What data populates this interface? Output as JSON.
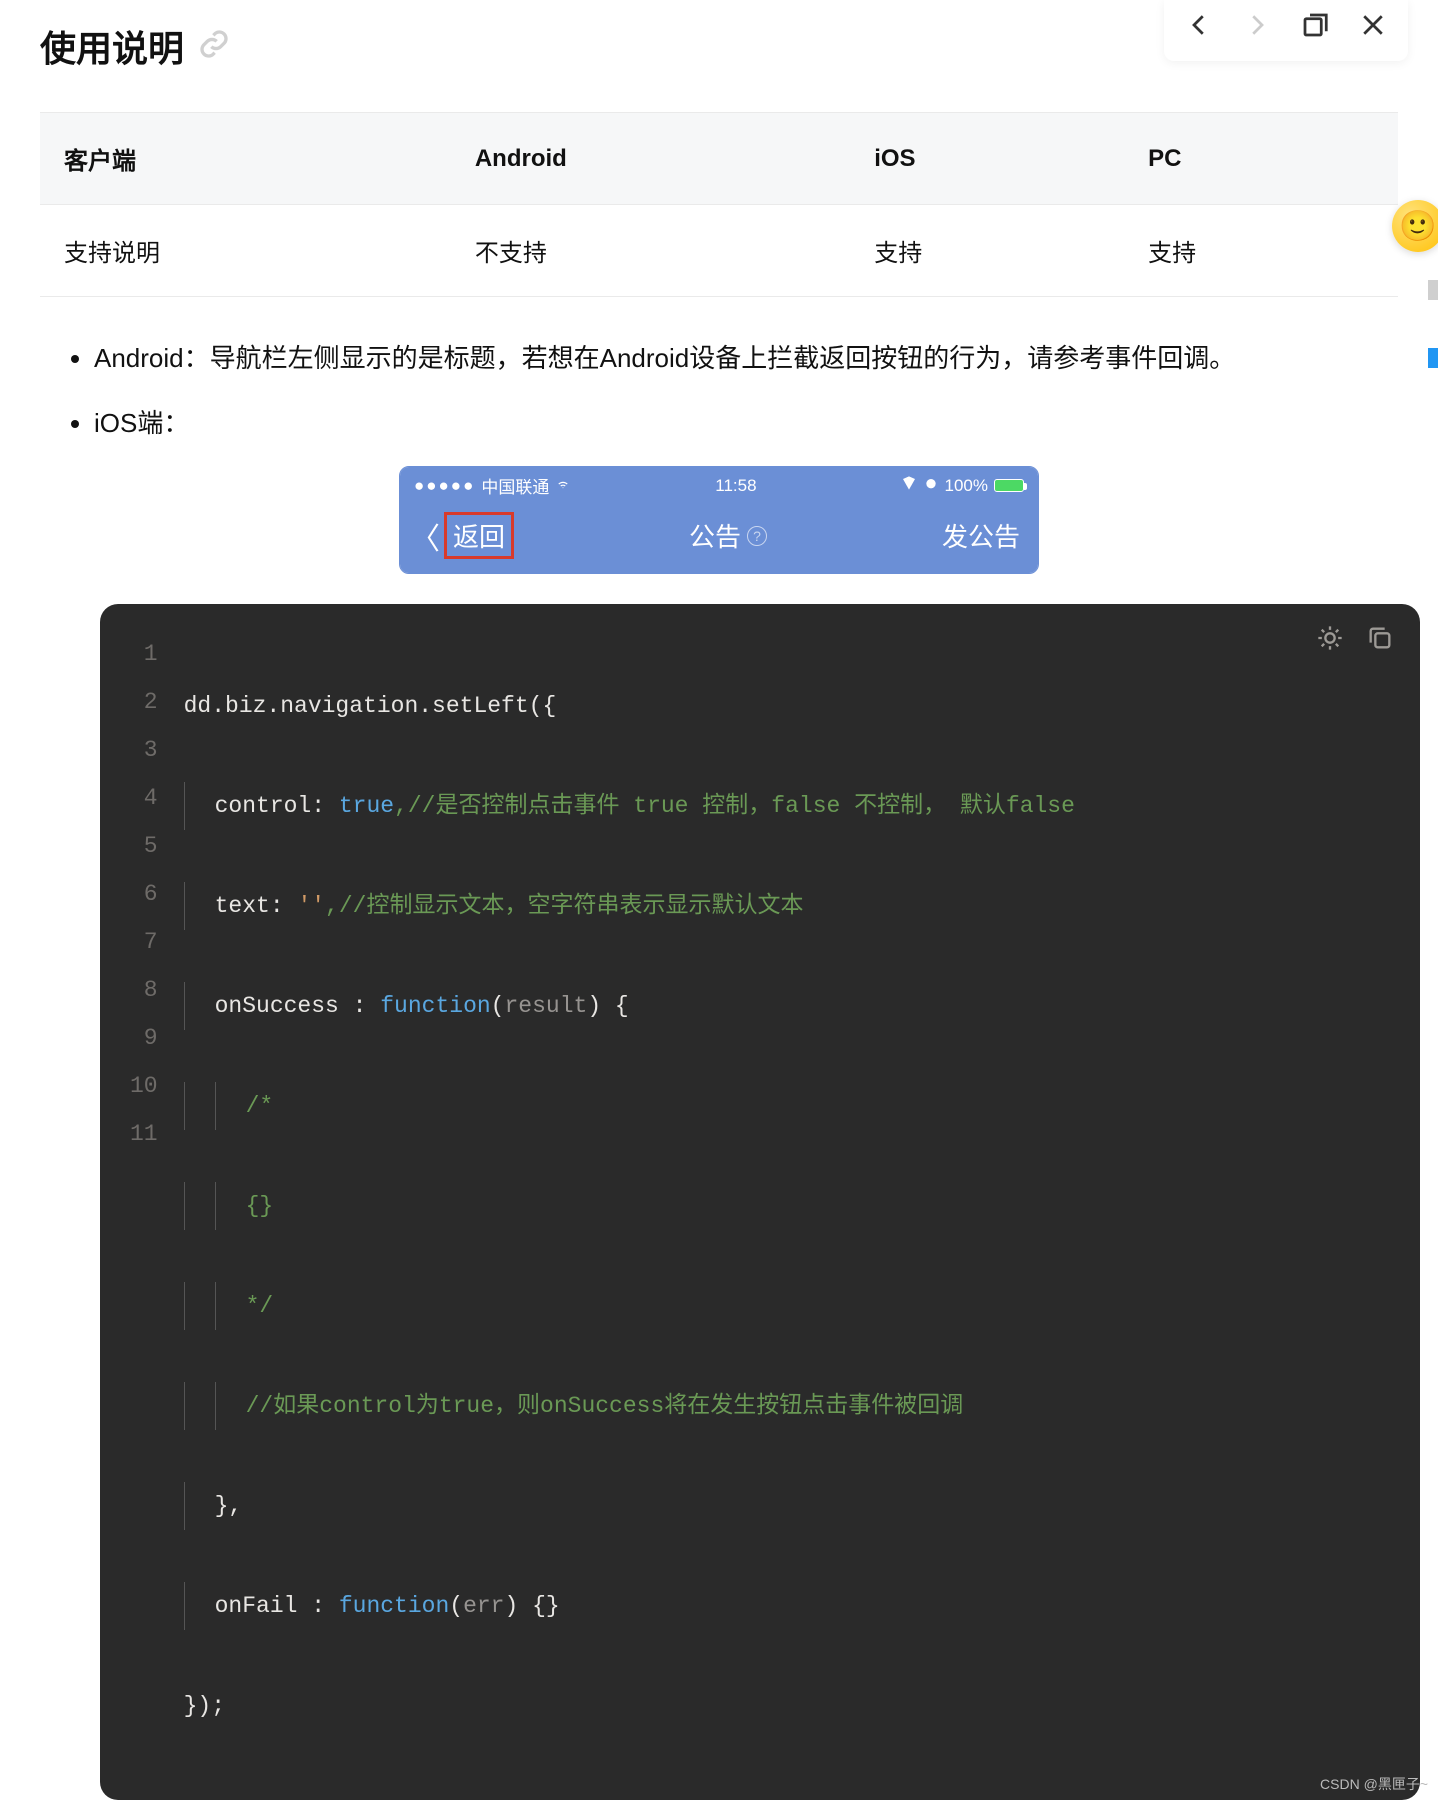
{
  "heading": "使用说明",
  "table": {
    "headers": [
      "客户端",
      "Android",
      "iOS",
      "PC"
    ],
    "row": [
      "支持说明",
      "不支持",
      "支持",
      "支持"
    ]
  },
  "notes": {
    "android": "Android：导航栏左侧显示的是标题，若想在Android设备上拦截返回按钮的行为，请参考事件回调。",
    "ios_label": "iOS端："
  },
  "ios_bar": {
    "carrier": "中国联通",
    "time": "11:58",
    "battery_pct": "100%",
    "back": "返回",
    "title": "公告",
    "right": "发公告"
  },
  "code": {
    "l1": "dd.biz.navigation.setLeft({",
    "l2_key": "control",
    "l2_val": "true",
    "l2_cm": ",//是否控制点击事件 true 控制，false 不控制， 默认false",
    "l3_key": "text",
    "l3_val": "''",
    "l3_cm": ",//控制显示文本，空字符串表示显示默认文本",
    "l4_a": "onSuccess : ",
    "l4_fn": "function",
    "l4_b": "(",
    "l4_p": "result",
    "l4_c": ") {",
    "l5": "/*",
    "l6": "{}",
    "l7": "*/",
    "l8": "//如果control为true，则onSuccess将在发生按钮点击事件被回调",
    "l9": "},",
    "l10_a": "onFail : ",
    "l10_fn": "function",
    "l10_b": "(",
    "l10_p": "err",
    "l10_c": ") {}",
    "l11": "});"
  },
  "watermark": "CSDN @黑匣子~"
}
